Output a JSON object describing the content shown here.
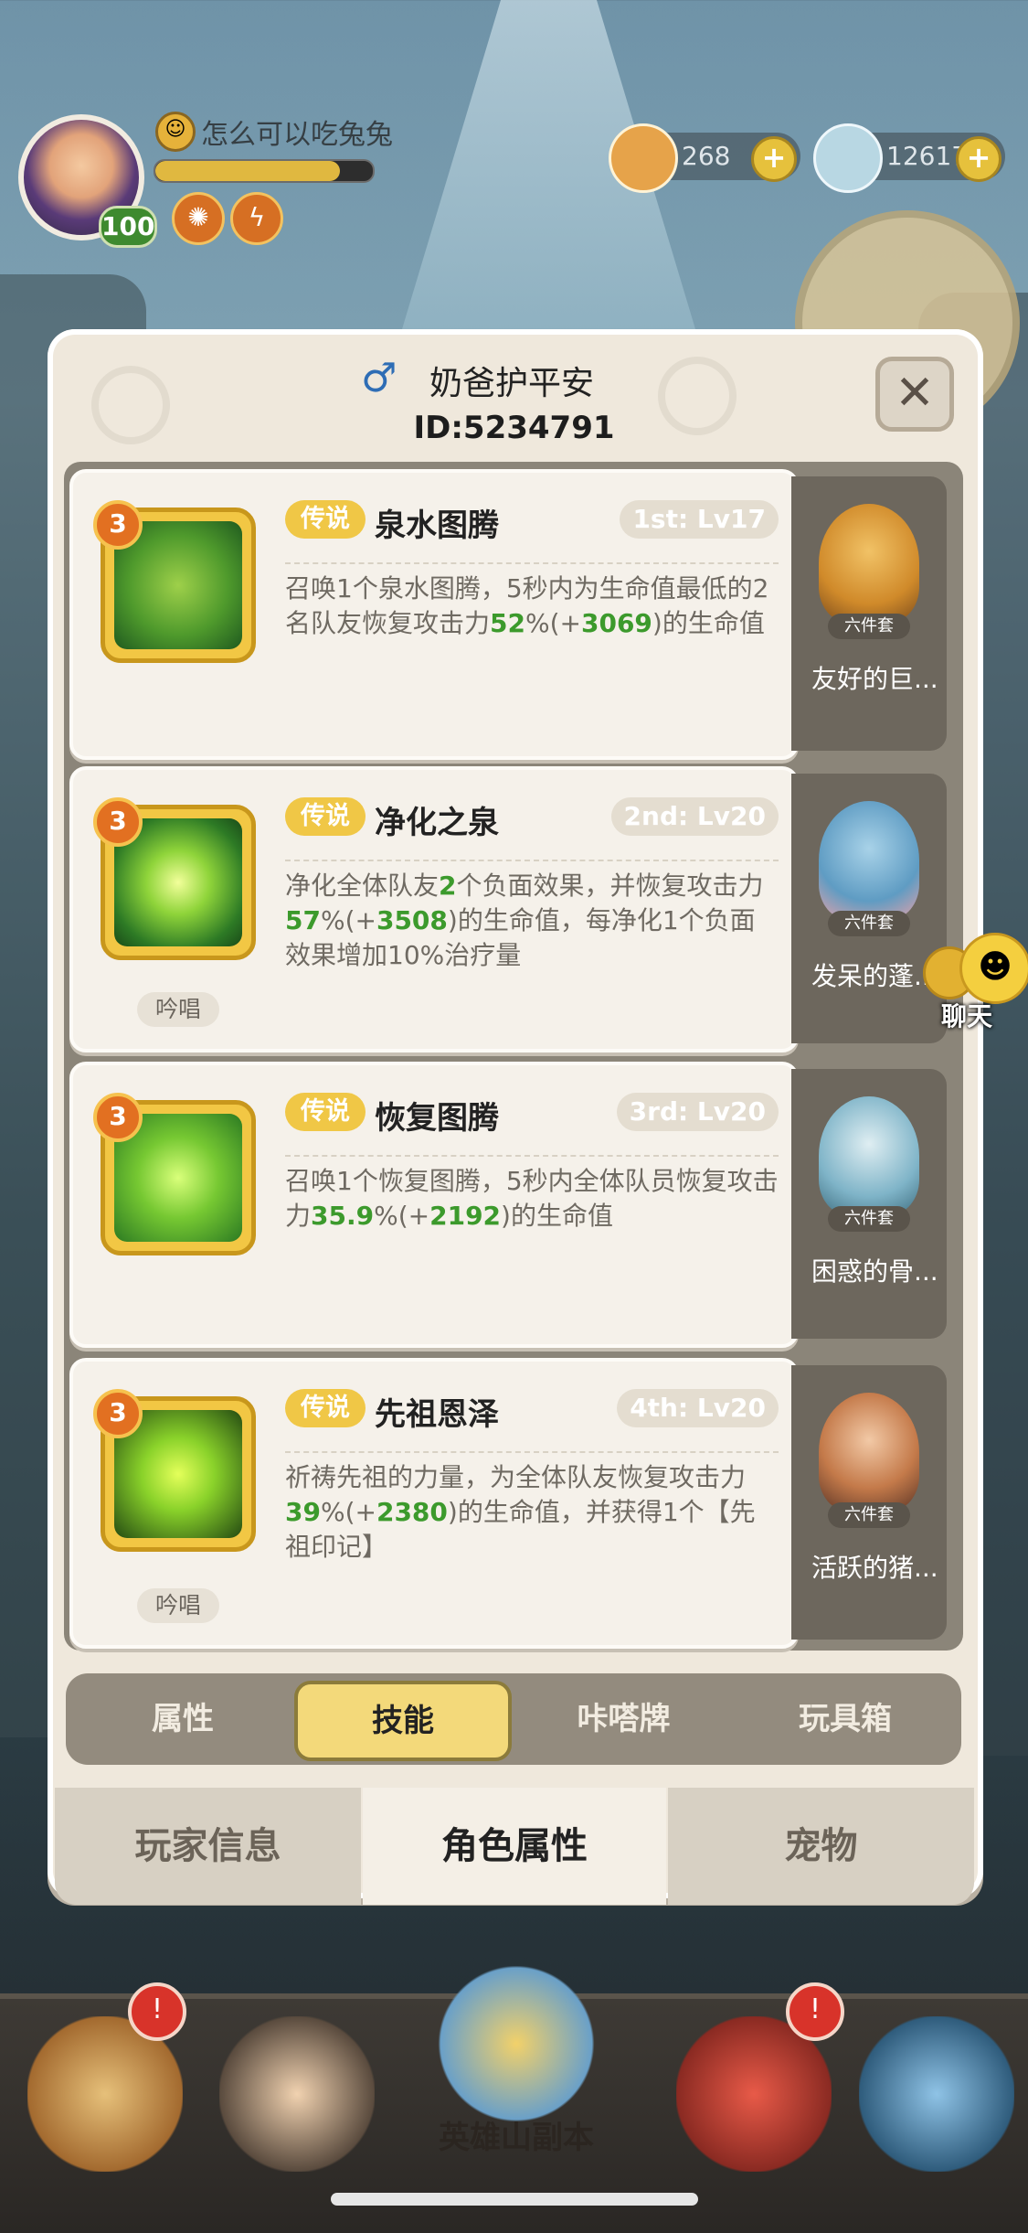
{
  "hud": {
    "level": "100",
    "player_name": "怎么可以吃兔兔",
    "exp_fraction": 0.85,
    "currency_1": "268",
    "currency_2": "126175"
  },
  "modal": {
    "gender_symbol": "♂",
    "name": "奶爸护平安",
    "id_text": "ID:5234791",
    "close_symbol": "✕"
  },
  "skills": [
    {
      "rank": "3",
      "tag": "传说",
      "name": "泉水图腾",
      "level": "1st: Lv17",
      "desc_parts": [
        "召唤1个泉水图腾，5秒内为生命值最低的2名队友恢复攻击力",
        "52",
        "%(+",
        "3069",
        ")的生命值"
      ],
      "chant": ""
    },
    {
      "rank": "3",
      "tag": "传说",
      "name": "净化之泉",
      "level": "2nd: Lv20",
      "desc_parts": [
        "净化全体队友",
        "2",
        "个负面效果，并恢复攻击力",
        "57",
        "%(+",
        "3508",
        ")的生命值，每净化1个负面效果增加10%治疗量"
      ],
      "chant": "吟唱"
    },
    {
      "rank": "3",
      "tag": "传说",
      "name": "恢复图腾",
      "level": "3rd: Lv20",
      "desc_parts": [
        "召唤1个恢复图腾，5秒内全体队员恢复攻击力",
        "35.9",
        "%(+",
        "2192",
        ")的生命值"
      ],
      "chant": ""
    },
    {
      "rank": "3",
      "tag": "传说",
      "name": "先祖恩泽",
      "level": "4th: Lv20",
      "desc_parts": [
        "祈祷先祖的力量，为全体队友恢复攻击力",
        "39",
        "%(+",
        "2380",
        ")的生命值，并获得1个【先祖印记】"
      ],
      "chant": "吟唱"
    }
  ],
  "outfits": [
    {
      "set": "六件套",
      "name": "友好的巨..."
    },
    {
      "set": "六件套",
      "name": "发呆的蓬..."
    },
    {
      "set": "六件套",
      "name": "困惑的骨..."
    },
    {
      "set": "六件套",
      "name": "活跃的猪..."
    }
  ],
  "tabs": [
    "属性",
    "技能",
    "咔嗒牌",
    "玩具箱"
  ],
  "bottom_tabs": [
    "玩家信息",
    "角色属性",
    "宠物"
  ],
  "chat_label": "聊天",
  "nav": {
    "center_label": "英雄山副本",
    "bell": "!"
  },
  "colors": {
    "accent": "#f0c746",
    "green": "#3c9a2c"
  }
}
